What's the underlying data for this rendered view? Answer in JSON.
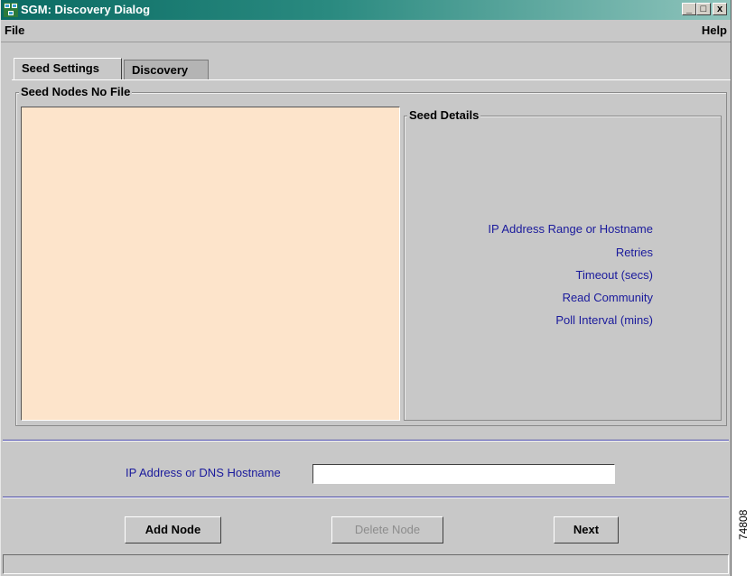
{
  "window": {
    "title": "SGM: Discovery Dialog",
    "icon": "app-network-icon"
  },
  "window_controls": {
    "minimize": "_",
    "maximize": "□",
    "close": "x"
  },
  "menubar": {
    "file": "File",
    "help": "Help"
  },
  "tabs": [
    {
      "label": "Seed Settings",
      "active": true
    },
    {
      "label": "Discovery",
      "active": false
    }
  ],
  "seed_nodes": {
    "title": "Seed Nodes  No File"
  },
  "seed_details": {
    "title": "Seed Details",
    "fields": [
      "IP Address Range or Hostname",
      "Retries",
      "Timeout (secs)",
      "Read Community",
      "Poll Interval (mins)"
    ]
  },
  "ip_entry": {
    "label": "IP Address or DNS Hostname",
    "value": ""
  },
  "buttons": {
    "add": "Add Node",
    "delete": "Delete Node",
    "next": "Next"
  },
  "figure_number": "74808",
  "colors": {
    "title_start": "#0a6b63",
    "list_bg": "#fde4cb",
    "label_blue": "#1a1a9c"
  }
}
